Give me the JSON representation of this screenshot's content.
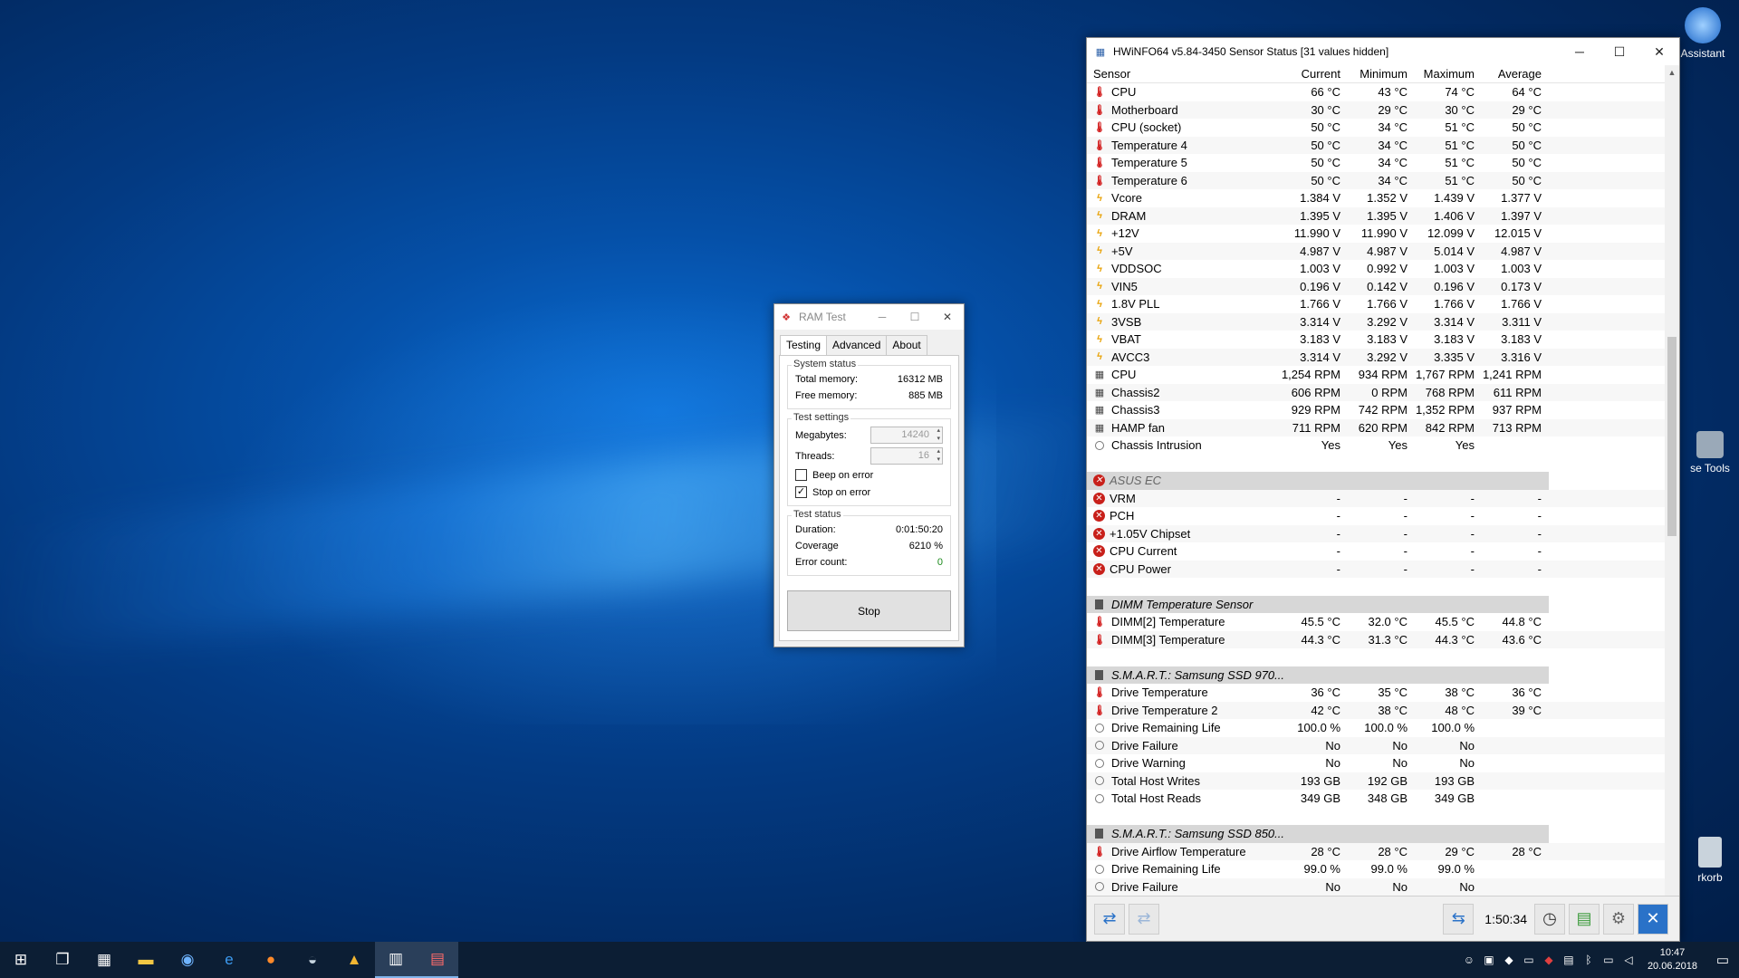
{
  "desktop": {
    "icons": [
      {
        "label": "Assistant"
      },
      {
        "label": "se Tools"
      },
      {
        "label": "rkorb"
      }
    ]
  },
  "hwinfo": {
    "title": "HWiNFO64 v5.84-3450 Sensor Status [31 values hidden]",
    "columns": [
      "Sensor",
      "Current",
      "Minimum",
      "Maximum",
      "Average"
    ],
    "rows": [
      {
        "kind": "temp",
        "name": "CPU",
        "cur": "66 °C",
        "min": "43 °C",
        "max": "74 °C",
        "avg": "64 °C"
      },
      {
        "kind": "temp",
        "name": "Motherboard",
        "cur": "30 °C",
        "min": "29 °C",
        "max": "30 °C",
        "avg": "29 °C"
      },
      {
        "kind": "temp",
        "name": "CPU (socket)",
        "cur": "50 °C",
        "min": "34 °C",
        "max": "51 °C",
        "avg": "50 °C"
      },
      {
        "kind": "temp",
        "name": "Temperature 4",
        "cur": "50 °C",
        "min": "34 °C",
        "max": "51 °C",
        "avg": "50 °C"
      },
      {
        "kind": "temp",
        "name": "Temperature 5",
        "cur": "50 °C",
        "min": "34 °C",
        "max": "51 °C",
        "avg": "50 °C"
      },
      {
        "kind": "temp",
        "name": "Temperature 6",
        "cur": "50 °C",
        "min": "34 °C",
        "max": "51 °C",
        "avg": "50 °C"
      },
      {
        "kind": "volt",
        "name": "Vcore",
        "cur": "1.384 V",
        "min": "1.352 V",
        "max": "1.439 V",
        "avg": "1.377 V"
      },
      {
        "kind": "volt",
        "name": "DRAM",
        "cur": "1.395 V",
        "min": "1.395 V",
        "max": "1.406 V",
        "avg": "1.397 V"
      },
      {
        "kind": "volt",
        "name": "+12V",
        "cur": "11.990 V",
        "min": "11.990 V",
        "max": "12.099 V",
        "avg": "12.015 V"
      },
      {
        "kind": "volt",
        "name": "+5V",
        "cur": "4.987 V",
        "min": "4.987 V",
        "max": "5.014 V",
        "avg": "4.987 V"
      },
      {
        "kind": "volt",
        "name": "VDDSOC",
        "cur": "1.003 V",
        "min": "0.992 V",
        "max": "1.003 V",
        "avg": "1.003 V"
      },
      {
        "kind": "volt",
        "name": "VIN5",
        "cur": "0.196 V",
        "min": "0.142 V",
        "max": "0.196 V",
        "avg": "0.173 V"
      },
      {
        "kind": "volt",
        "name": "1.8V PLL",
        "cur": "1.766 V",
        "min": "1.766 V",
        "max": "1.766 V",
        "avg": "1.766 V"
      },
      {
        "kind": "volt",
        "name": "3VSB",
        "cur": "3.314 V",
        "min": "3.292 V",
        "max": "3.314 V",
        "avg": "3.311 V"
      },
      {
        "kind": "volt",
        "name": "VBAT",
        "cur": "3.183 V",
        "min": "3.183 V",
        "max": "3.183 V",
        "avg": "3.183 V"
      },
      {
        "kind": "volt",
        "name": "AVCC3",
        "cur": "3.314 V",
        "min": "3.292 V",
        "max": "3.335 V",
        "avg": "3.316 V"
      },
      {
        "kind": "fan",
        "name": "CPU",
        "cur": "1,254 RPM",
        "min": "934 RPM",
        "max": "1,767 RPM",
        "avg": "1,241 RPM"
      },
      {
        "kind": "fan",
        "name": "Chassis2",
        "cur": "606 RPM",
        "min": "0 RPM",
        "max": "768 RPM",
        "avg": "611 RPM"
      },
      {
        "kind": "fan",
        "name": "Chassis3",
        "cur": "929 RPM",
        "min": "742 RPM",
        "max": "1,352 RPM",
        "avg": "937 RPM"
      },
      {
        "kind": "fan",
        "name": "HAMP fan",
        "cur": "711 RPM",
        "min": "620 RPM",
        "max": "842 RPM",
        "avg": "713 RPM"
      },
      {
        "kind": "other",
        "name": "Chassis Intrusion",
        "cur": "Yes",
        "min": "Yes",
        "max": "Yes",
        "avg": ""
      },
      {
        "kind": "blank"
      },
      {
        "kind": "group-err",
        "name": "ASUS EC"
      },
      {
        "kind": "err",
        "name": "VRM",
        "cur": "-",
        "min": "-",
        "max": "-",
        "avg": "-"
      },
      {
        "kind": "err",
        "name": "PCH",
        "cur": "-",
        "min": "-",
        "max": "-",
        "avg": "-"
      },
      {
        "kind": "err",
        "name": "+1.05V Chipset",
        "cur": "-",
        "min": "-",
        "max": "-",
        "avg": "-"
      },
      {
        "kind": "err",
        "name": "CPU Current",
        "cur": "-",
        "min": "-",
        "max": "-",
        "avg": "-"
      },
      {
        "kind": "err",
        "name": "CPU Power",
        "cur": "-",
        "min": "-",
        "max": "-",
        "avg": "-"
      },
      {
        "kind": "blank"
      },
      {
        "kind": "group",
        "name": "DIMM Temperature Sensor"
      },
      {
        "kind": "temp",
        "name": "DIMM[2] Temperature",
        "cur": "45.5 °C",
        "min": "32.0 °C",
        "max": "45.5 °C",
        "avg": "44.8 °C"
      },
      {
        "kind": "temp",
        "name": "DIMM[3] Temperature",
        "cur": "44.3 °C",
        "min": "31.3 °C",
        "max": "44.3 °C",
        "avg": "43.6 °C"
      },
      {
        "kind": "blank"
      },
      {
        "kind": "group",
        "name": "S.M.A.R.T.: Samsung SSD 970..."
      },
      {
        "kind": "temp",
        "name": "Drive Temperature",
        "cur": "36 °C",
        "min": "35 °C",
        "max": "38 °C",
        "avg": "36 °C"
      },
      {
        "kind": "temp",
        "name": "Drive Temperature 2",
        "cur": "42 °C",
        "min": "38 °C",
        "max": "48 °C",
        "avg": "39 °C"
      },
      {
        "kind": "other",
        "name": "Drive Remaining Life",
        "cur": "100.0 %",
        "min": "100.0 %",
        "max": "100.0 %",
        "avg": ""
      },
      {
        "kind": "other",
        "name": "Drive Failure",
        "cur": "No",
        "min": "No",
        "max": "No",
        "avg": ""
      },
      {
        "kind": "other",
        "name": "Drive Warning",
        "cur": "No",
        "min": "No",
        "max": "No",
        "avg": ""
      },
      {
        "kind": "other",
        "name": "Total Host Writes",
        "cur": "193 GB",
        "min": "192 GB",
        "max": "193 GB",
        "avg": ""
      },
      {
        "kind": "other",
        "name": "Total Host Reads",
        "cur": "349 GB",
        "min": "348 GB",
        "max": "349 GB",
        "avg": ""
      },
      {
        "kind": "blank"
      },
      {
        "kind": "group",
        "name": "S.M.A.R.T.: Samsung SSD 850..."
      },
      {
        "kind": "temp",
        "name": "Drive Airflow Temperature",
        "cur": "28 °C",
        "min": "28 °C",
        "max": "29 °C",
        "avg": "28 °C"
      },
      {
        "kind": "other",
        "name": "Drive Remaining Life",
        "cur": "99.0 %",
        "min": "99.0 %",
        "max": "99.0 %",
        "avg": ""
      },
      {
        "kind": "other",
        "name": "Drive Failure",
        "cur": "No",
        "min": "No",
        "max": "No",
        "avg": ""
      }
    ],
    "footer": {
      "elapsed": "1:50:34"
    }
  },
  "ramtest": {
    "title": "RAM Test",
    "tabs": [
      "Testing",
      "Advanced",
      "About"
    ],
    "system_status": {
      "label": "System status",
      "total_label": "Total memory:",
      "total_value": "16312 MB",
      "free_label": "Free memory:",
      "free_value": "885 MB"
    },
    "test_settings": {
      "label": "Test settings",
      "mb_label": "Megabytes:",
      "mb_value": "14240",
      "threads_label": "Threads:",
      "threads_value": "16",
      "beep_label": "Beep on error",
      "beep_checked": false,
      "stop_label": "Stop on error",
      "stop_checked": true
    },
    "test_status": {
      "label": "Test status",
      "duration_label": "Duration:",
      "duration_value": "0:01:50:20",
      "coverage_label": "Coverage",
      "coverage_value": "6210 %",
      "errors_label": "Error count:",
      "errors_value": "0"
    },
    "stop_button": "Stop"
  },
  "taskbar": {
    "clock_time": "10:47",
    "clock_date": "20.06.2018"
  }
}
